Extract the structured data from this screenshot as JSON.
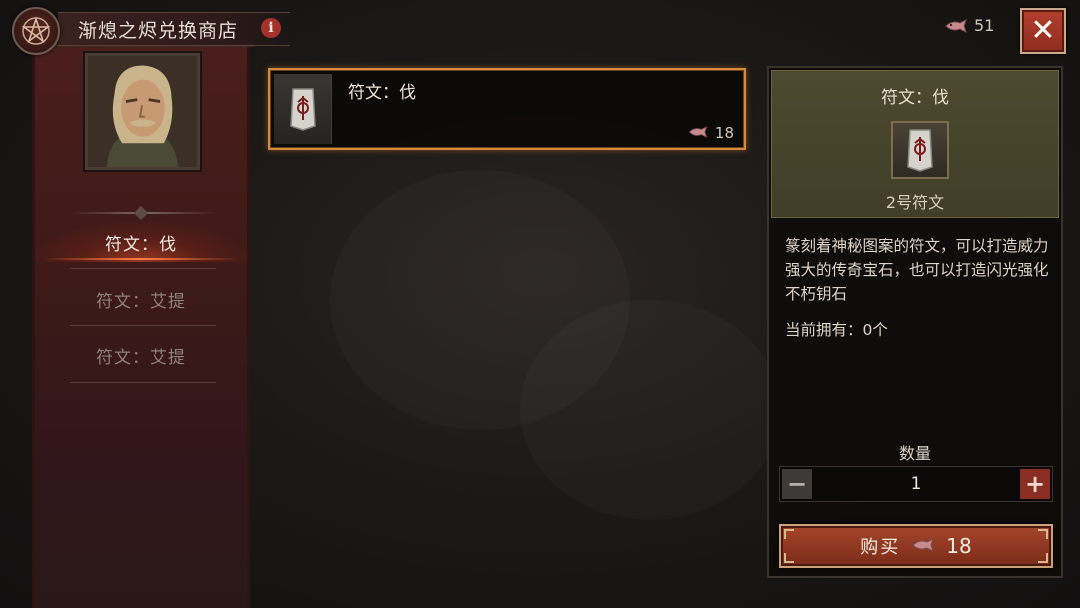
{
  "shop": {
    "title": "渐熄之烬兑换商店"
  },
  "currency": {
    "amount": "51",
    "icon": "ember-fish-icon"
  },
  "sidebar": {
    "items": [
      {
        "label": "符文：伐",
        "active": true
      },
      {
        "label": "符文：艾提",
        "active": false
      },
      {
        "label": "符文：艾提",
        "active": false
      }
    ]
  },
  "item_list": [
    {
      "name": "符文：伐",
      "price": "18"
    }
  ],
  "detail": {
    "title": "符文：伐",
    "subtitle": "2号符文",
    "description": "篆刻着神秘图案的符文，可以打造威力强大的传奇宝石，也可以打造闪光强化不朽钥石",
    "owned": "当前拥有：0个",
    "quantity_label": "数量",
    "quantity": "1",
    "buy_label": "购买",
    "buy_price": "18"
  },
  "colors": {
    "accent_orange": "#d48a3a",
    "button_red": "#a5452a",
    "panel_olive": "#4e4a30"
  }
}
